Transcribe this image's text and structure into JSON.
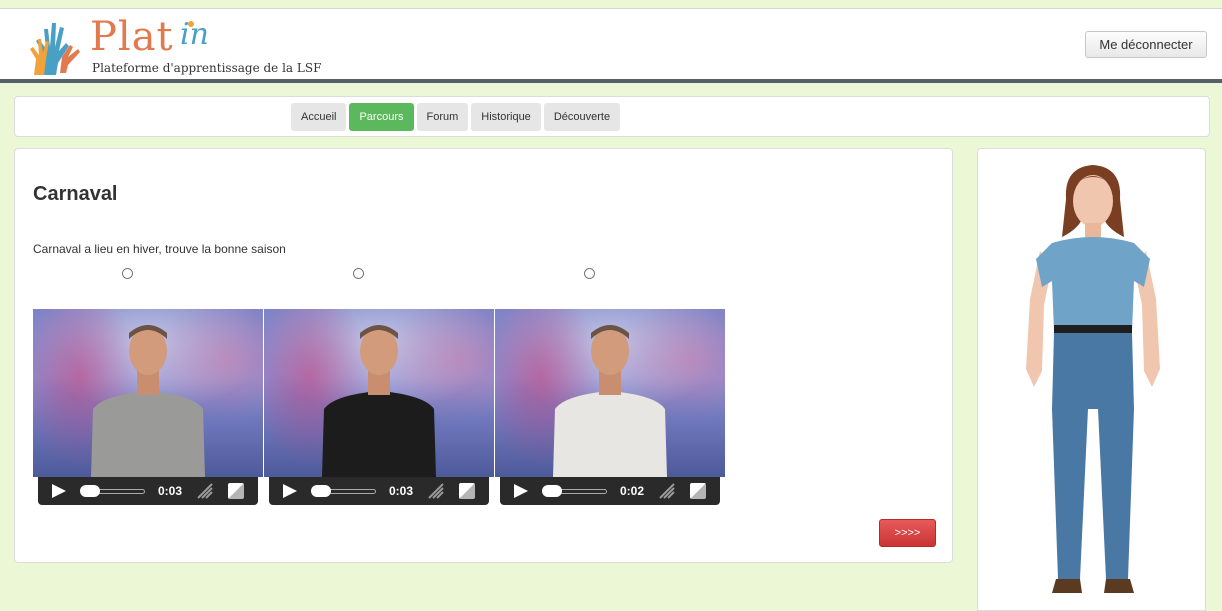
{
  "header": {
    "logo_word": "Plat",
    "logo_in": "in",
    "logo_subtitle": "Plateforme d'apprentissage de la LSF",
    "logout_label": "Me déconnecter"
  },
  "nav": {
    "tabs": [
      {
        "label": "Accueil",
        "active": false
      },
      {
        "label": "Parcours",
        "active": true
      },
      {
        "label": "Forum",
        "active": false
      },
      {
        "label": "Historique",
        "active": false
      },
      {
        "label": "Découverte",
        "active": false
      }
    ]
  },
  "main": {
    "title": "Carnaval",
    "question": "Carnaval a lieu en hiver, trouve la bonne saison",
    "videos": [
      {
        "time": "0:03",
        "shirt_color": "#9a9a98",
        "progress": 0.0
      },
      {
        "time": "0:03",
        "shirt_color": "#1c1c1c",
        "progress": 0.0
      },
      {
        "time": "0:02",
        "shirt_color": "#e8e6e2",
        "progress": 0.0
      }
    ],
    "next_label": ">>>>"
  },
  "colors": {
    "accent_green": "#5cb85c",
    "next_red": "#d9434a",
    "page_bg": "#ecf7d6",
    "logo_orange": "#e27a4e",
    "logo_blue": "#4aa0c4"
  }
}
